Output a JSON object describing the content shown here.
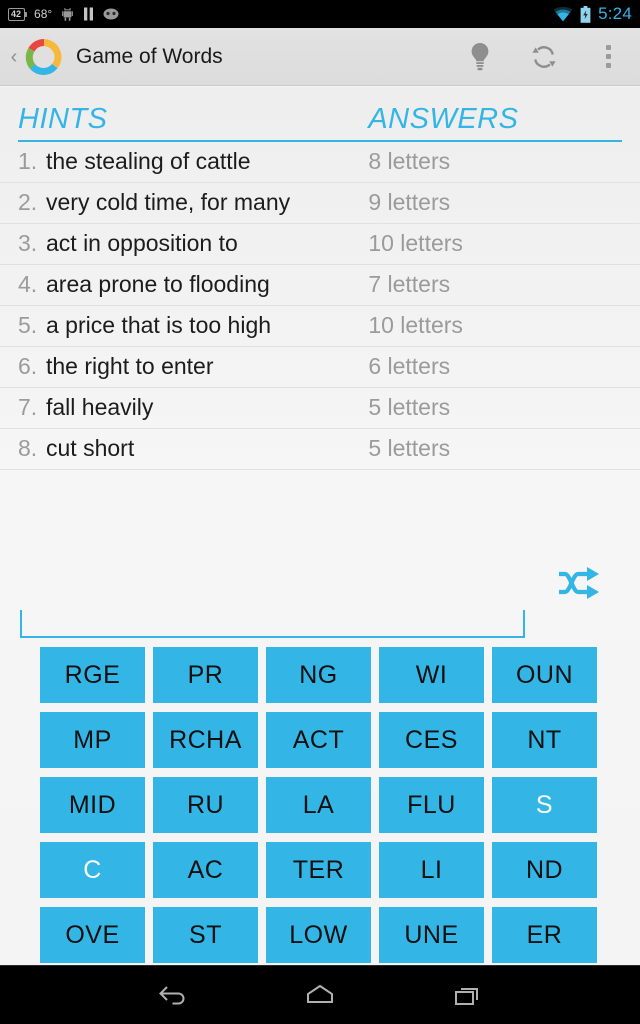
{
  "statusbar": {
    "battery_level": "42",
    "temperature": "68°",
    "icons": [
      "battery-level-icon",
      "android-robot-icon",
      "pause-icon",
      "cyanogenmod-icon"
    ],
    "wifi_icon": "wifi-icon",
    "charging_icon": "battery-charging-icon",
    "time": "5:24"
  },
  "actionbar": {
    "back_label": "‹",
    "app_icon": "game-of-words-ring-logo",
    "title": "Game of Words",
    "hint_button": "lightbulb-icon",
    "refresh_button": "refresh-icon",
    "overflow_button": "overflow-menu-icon"
  },
  "table": {
    "header_hints": "HINTS",
    "header_answers": "ANSWERS",
    "rows": [
      {
        "num": "1.",
        "hint": "the stealing of cattle",
        "answer": "8 letters"
      },
      {
        "num": "2.",
        "hint": "very cold time, for many",
        "answer": "9 letters"
      },
      {
        "num": "3.",
        "hint": "act in opposition to",
        "answer": "10 letters"
      },
      {
        "num": "4.",
        "hint": "area prone to flooding",
        "answer": "7 letters"
      },
      {
        "num": "5.",
        "hint": "a price that is too high",
        "answer": "10 letters"
      },
      {
        "num": "6.",
        "hint": "the right to enter",
        "answer": "6 letters"
      },
      {
        "num": "7.",
        "hint": "fall heavily",
        "answer": "5 letters"
      },
      {
        "num": "8.",
        "hint": "cut short",
        "answer": "5 letters"
      }
    ]
  },
  "shuffle_button": "shuffle-icon",
  "answer_field": {
    "value": "",
    "placeholder": ""
  },
  "tiles": {
    "rows": [
      [
        {
          "text": "RGE",
          "used": false
        },
        {
          "text": "PR",
          "used": false
        },
        {
          "text": "NG",
          "used": false
        },
        {
          "text": "WI",
          "used": false
        },
        {
          "text": "OUN",
          "used": false
        }
      ],
      [
        {
          "text": "MP",
          "used": false
        },
        {
          "text": "RCHA",
          "used": false
        },
        {
          "text": "ACT",
          "used": false
        },
        {
          "text": "CES",
          "used": false
        },
        {
          "text": "NT",
          "used": false
        }
      ],
      [
        {
          "text": "MID",
          "used": false
        },
        {
          "text": "RU",
          "used": false
        },
        {
          "text": "LA",
          "used": false
        },
        {
          "text": "FLU",
          "used": false
        },
        {
          "text": "S",
          "used": true
        }
      ],
      [
        {
          "text": "C",
          "used": true
        },
        {
          "text": "AC",
          "used": false
        },
        {
          "text": "TER",
          "used": false
        },
        {
          "text": "LI",
          "used": false
        },
        {
          "text": "ND",
          "used": false
        }
      ],
      [
        {
          "text": "OVE",
          "used": false
        },
        {
          "text": "ST",
          "used": false
        },
        {
          "text": "LOW",
          "used": false
        },
        {
          "text": "UNE",
          "used": false
        },
        {
          "text": "ER",
          "used": false
        }
      ]
    ]
  },
  "navbar": {
    "back": "nav-back-icon",
    "home": "nav-home-icon",
    "recents": "nav-recents-icon"
  },
  "colors": {
    "accent": "#33b5e5",
    "tile": "#33b5e5",
    "background": "#f4f4f4",
    "actionbar": "#e0e0e0"
  }
}
